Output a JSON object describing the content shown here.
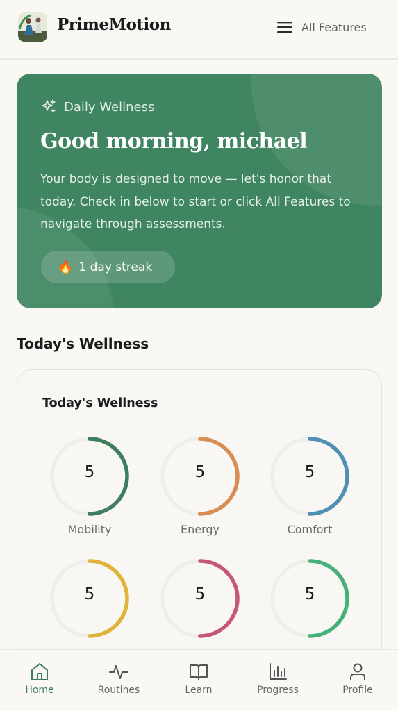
{
  "app": {
    "brand": "PrimeMotion",
    "menu_label": "All Features"
  },
  "hero": {
    "tag": "Daily Wellness",
    "greeting": "Good morning, michael",
    "description": "Your body is designed to move — let's honor that today. Check in below to start or click All Features to navigate through assessments.",
    "streak": "1 day streak",
    "background": "#3f8561"
  },
  "section_title": "Today's Wellness",
  "wellness_card": {
    "title": "Today's Wellness",
    "metrics": [
      {
        "label": "Mobility",
        "value": "5",
        "fraction": 0.5,
        "color": "#3f7e5c"
      },
      {
        "label": "Energy",
        "value": "5",
        "fraction": 0.5,
        "color": "#d98d52"
      },
      {
        "label": "Comfort",
        "value": "5",
        "fraction": 0.5,
        "color": "#4f90b3"
      },
      {
        "label": "",
        "value": "5",
        "fraction": 0.5,
        "color": "#e0b43a"
      },
      {
        "label": "",
        "value": "5",
        "fraction": 0.5,
        "color": "#c5587a"
      },
      {
        "label": "",
        "value": "5",
        "fraction": 0.5,
        "color": "#45b07a"
      }
    ]
  },
  "nav": {
    "items": [
      {
        "label": "Home",
        "icon": "home-icon",
        "active": true
      },
      {
        "label": "Routines",
        "icon": "activity-icon",
        "active": false
      },
      {
        "label": "Learn",
        "icon": "book-icon",
        "active": false
      },
      {
        "label": "Progress",
        "icon": "bar-chart-icon",
        "active": false
      },
      {
        "label": "Profile",
        "icon": "user-icon",
        "active": false
      }
    ]
  },
  "colors": {
    "accent": "#3f7e5c",
    "track": "#efeeea"
  }
}
